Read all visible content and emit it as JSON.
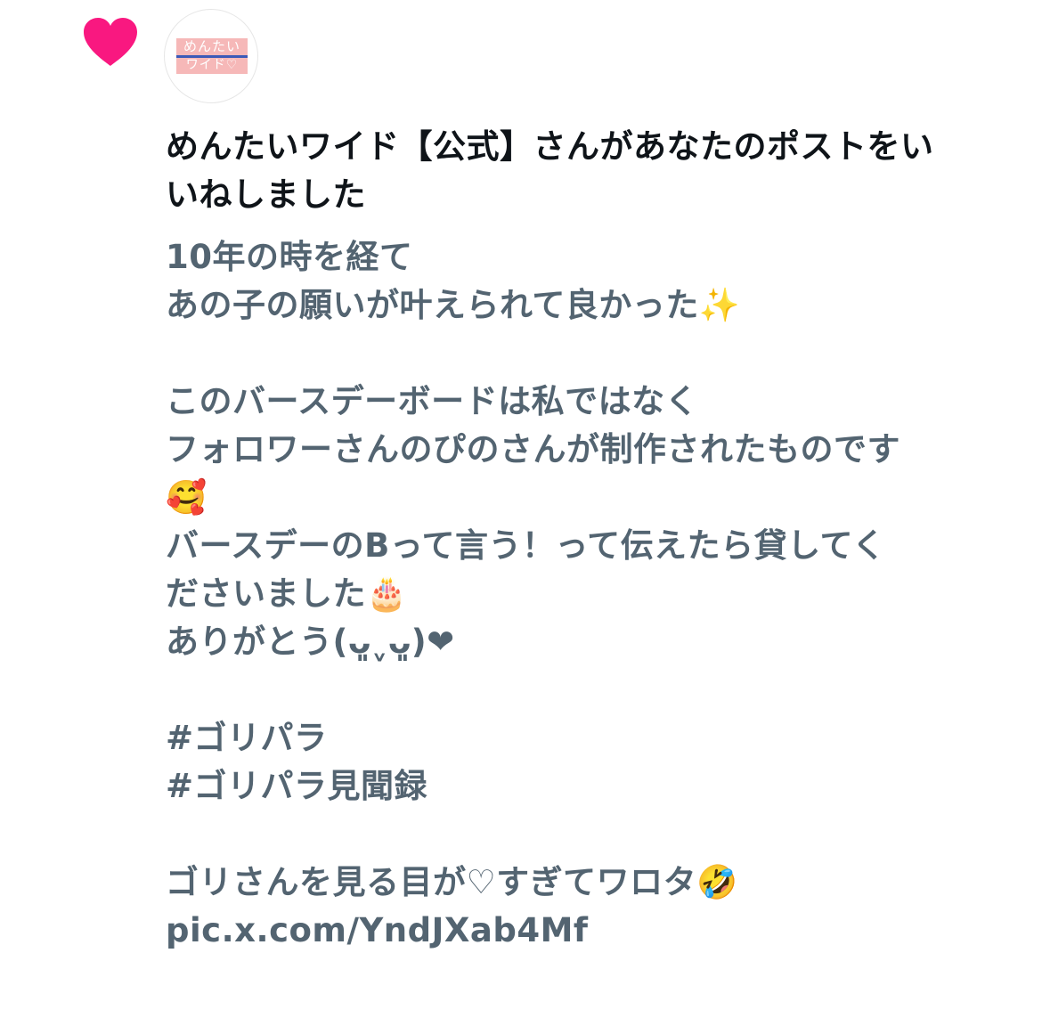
{
  "notification": {
    "icon": "heart-icon",
    "accent_color": "#f91880",
    "avatar_logo": {
      "line1": "めんたい",
      "line2": "ワイド♡"
    },
    "headline_line1": "めんたいワイド【公式】さんがあなたのポストをい",
    "headline_line2": "いねしました"
  },
  "post": {
    "lines": [
      "10年の時を経て",
      "あの子の願いが叶えられて良かった✨",
      "",
      "このバースデーボードは私ではなく",
      "フォロワーさんのぴのさんが制作されたものです",
      "🥰",
      "バースデーのBって言う！って伝えたら貸してく",
      "ださいました🎂",
      "ありがとう(ᴗ͈ˬᴗ͈)❤",
      "",
      "#ゴリパラ",
      "#ゴリパラ見聞録",
      "",
      "ゴリさんを見る目が♡すぎてワロタ🤣"
    ],
    "link": "pic.x.com/YndJXab4Mf"
  },
  "colors": {
    "headline": "#0f1419",
    "body_text": "#536471",
    "heart": "#f91880"
  }
}
